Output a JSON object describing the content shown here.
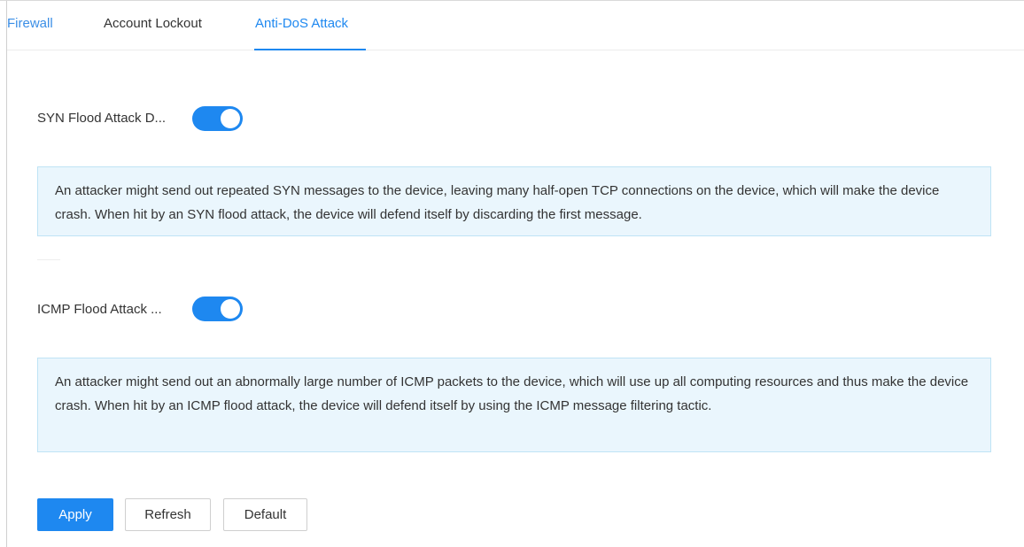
{
  "tabs": [
    {
      "label": "Firewall"
    },
    {
      "label": "Account Lockout"
    },
    {
      "label": "Anti-DoS Attack"
    }
  ],
  "active_tab": "Anti-DoS Attack",
  "syn": {
    "label": "SYN Flood Attack D...",
    "enabled": true,
    "info": "An attacker might send out repeated SYN messages to the device, leaving many half-open TCP connections on the device, which will make the device crash. When hit by an SYN flood attack, the device will defend itself by discarding the first message."
  },
  "icmp": {
    "label": "ICMP Flood Attack ...",
    "enabled": true,
    "info": "An attacker might send out an abnormally large number of ICMP packets to the device, which will use up all computing resources and thus make the device crash. When hit by an ICMP flood attack, the device will defend itself by using the ICMP message filtering tactic."
  },
  "buttons": {
    "apply": "Apply",
    "refresh": "Refresh",
    "default": "Default"
  },
  "colors": {
    "accent": "#1e88f0",
    "info_bg": "#eaf6fd",
    "info_border": "#bfe3f5"
  }
}
